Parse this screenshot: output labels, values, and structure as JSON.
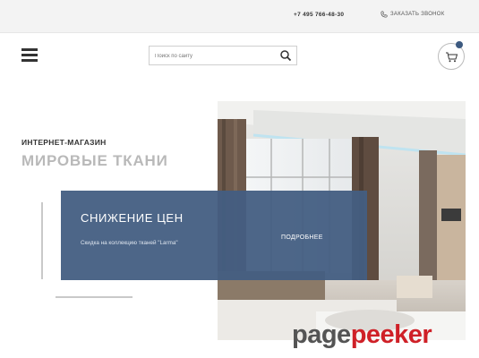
{
  "topbar": {
    "phone": "+7 495 766-48-30",
    "callback_label": "ЗАКАЗАТЬ ЗВОНОК",
    "callback_icon": "phone-icon"
  },
  "header": {
    "menu_icon": "hamburger-icon",
    "search": {
      "placeholder": "Поиск по сайту",
      "value": "",
      "icon": "search-icon"
    },
    "cart_icon": "cart-icon",
    "accent_color": "#3d5a80"
  },
  "hero": {
    "kicker": "ИНТЕРНЕТ-МАГАЗИН",
    "title": "МИРОВЫЕ ТКАНИ",
    "promo": {
      "title": "СНИЖЕНИЕ ЦЕН",
      "text": "Скидка на коллекцию тканей \"Larma\"",
      "more_label": "ПОДРОБНЕЕ",
      "background": "#435e82"
    }
  },
  "watermark": {
    "part1": "page",
    "part2": "peeker"
  }
}
